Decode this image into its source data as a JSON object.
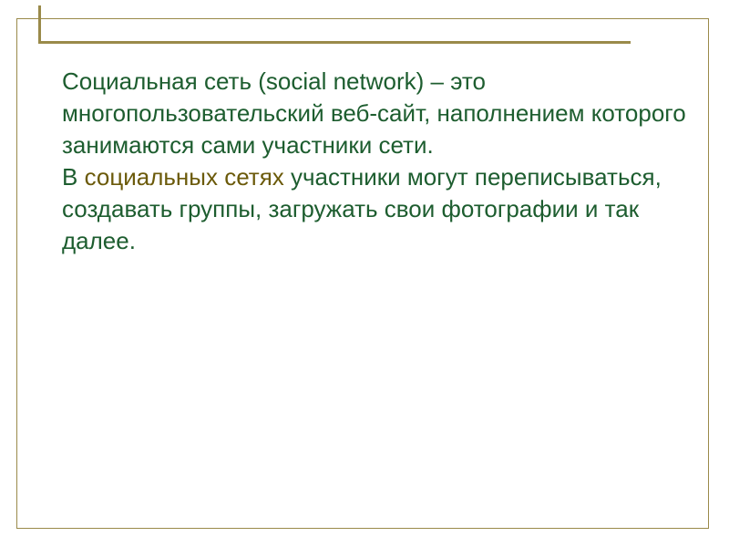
{
  "slide": {
    "p1_prefix": "Социальная сеть (social network)",
    "p1_rest": " – это многопользовательский веб-сайт, наполнением которого занимаются сами участники сети.",
    "p2_prefix": "В ",
    "p2_highlight": "социальных сетях",
    "p2_rest": " участники могут переписываться, создавать группы, загружать свои фотографии и так далее."
  }
}
